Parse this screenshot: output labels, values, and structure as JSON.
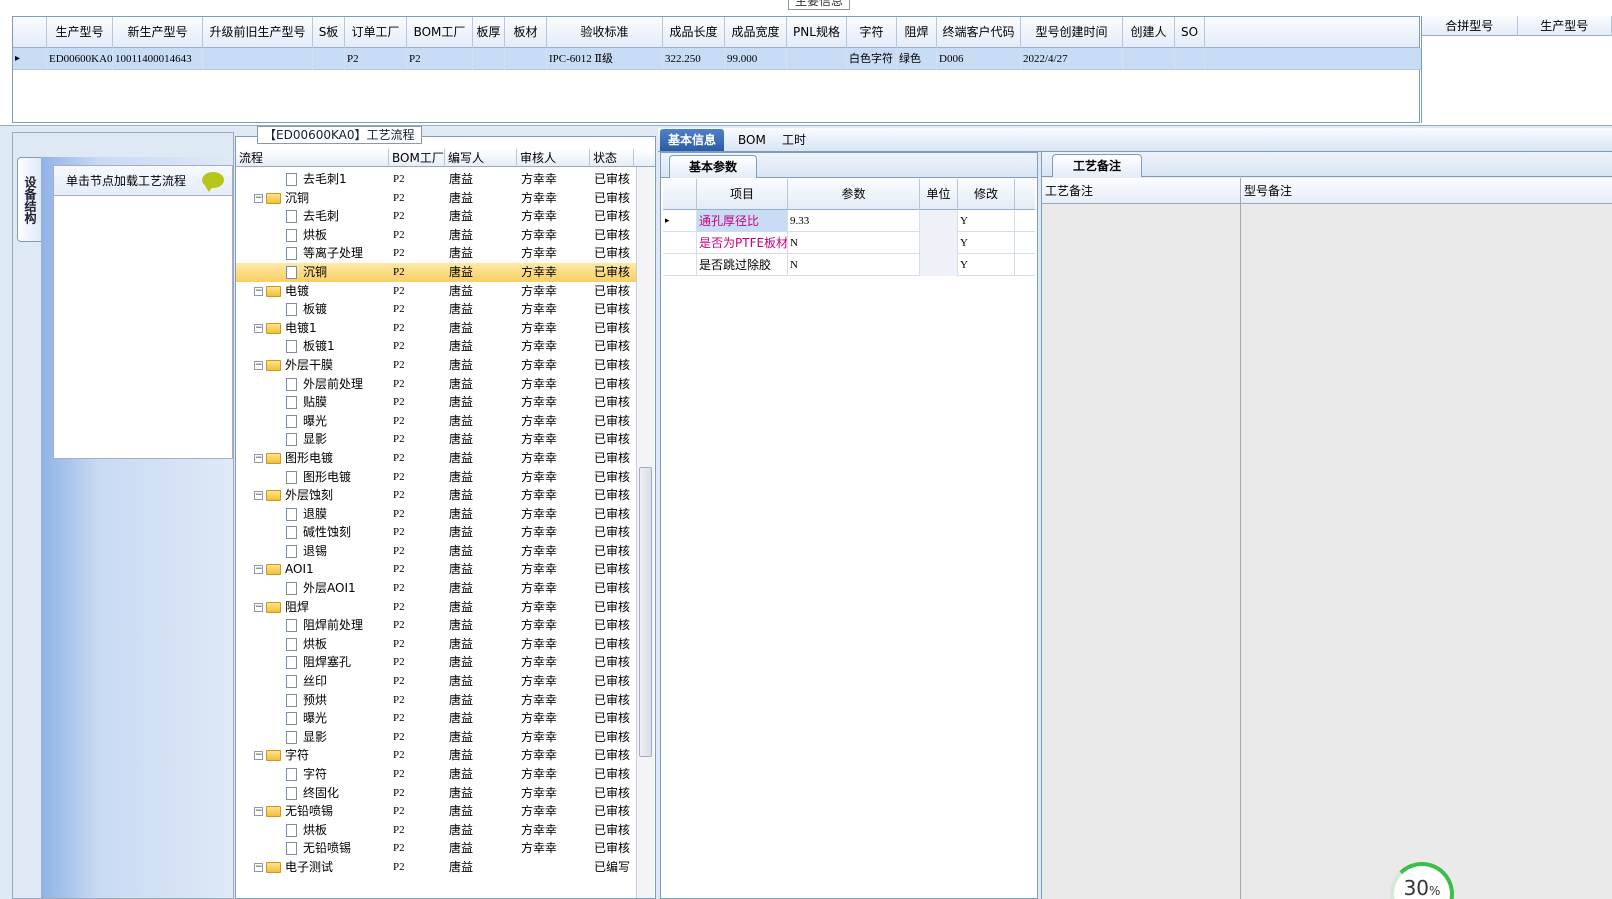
{
  "top": {
    "title": "主要信息",
    "headers": [
      "",
      "生产型号",
      "新生产型号",
      "升级前旧生产型号",
      "S板",
      "订单工厂",
      "BOM工厂",
      "板厚",
      "板材",
      "验收标准",
      "成品长度",
      "成品宽度",
      "PNL规格",
      "字符",
      "阻焊",
      "终端客户代码",
      "型号创建时间",
      "创建人",
      "SO"
    ],
    "row": [
      "",
      "ED00600KA0",
      "10011400014643",
      "",
      "",
      "P2",
      "P2",
      "",
      "",
      "IPC-6012 Ⅱ级",
      "322.250",
      "99.000",
      "",
      "白色字符",
      "绿色",
      "D006",
      "2022/4/27",
      "",
      ""
    ],
    "merge_headers": [
      "合拼型号",
      "生产型号"
    ]
  },
  "left": {
    "side_tab": "设备结构",
    "load_text": "单击节点加载工艺流程"
  },
  "tree": {
    "caption": "【ED00600KA0】工艺流程",
    "headers": [
      "流程",
      "BOM工厂",
      "编写人",
      "审核人",
      "状态"
    ],
    "rows": [
      {
        "name": "去毛刺1",
        "type": "doc",
        "bom": "P2",
        "writer": "唐益",
        "reviewer": "方幸幸",
        "status": "已审核"
      },
      {
        "name": "沉铜",
        "type": "folder",
        "bom": "P2",
        "writer": "唐益",
        "reviewer": "方幸幸",
        "status": "已审核"
      },
      {
        "name": "去毛刺",
        "type": "doc",
        "bom": "P2",
        "writer": "唐益",
        "reviewer": "方幸幸",
        "status": "已审核"
      },
      {
        "name": "烘板",
        "type": "doc",
        "bom": "P2",
        "writer": "唐益",
        "reviewer": "方幸幸",
        "status": "已审核"
      },
      {
        "name": "等离子处理",
        "type": "doc",
        "bom": "P2",
        "writer": "唐益",
        "reviewer": "方幸幸",
        "status": "已审核"
      },
      {
        "name": "沉铜",
        "type": "doc",
        "bom": "P2",
        "writer": "唐益",
        "reviewer": "方幸幸",
        "status": "已审核",
        "selected": true
      },
      {
        "name": "电镀",
        "type": "folder",
        "bom": "P2",
        "writer": "唐益",
        "reviewer": "方幸幸",
        "status": "已审核"
      },
      {
        "name": "板镀",
        "type": "doc",
        "bom": "P2",
        "writer": "唐益",
        "reviewer": "方幸幸",
        "status": "已审核"
      },
      {
        "name": "电镀1",
        "type": "folder",
        "bom": "P2",
        "writer": "唐益",
        "reviewer": "方幸幸",
        "status": "已审核"
      },
      {
        "name": "板镀1",
        "type": "doc",
        "bom": "P2",
        "writer": "唐益",
        "reviewer": "方幸幸",
        "status": "已审核"
      },
      {
        "name": "外层干膜",
        "type": "folder",
        "bom": "P2",
        "writer": "唐益",
        "reviewer": "方幸幸",
        "status": "已审核"
      },
      {
        "name": "外层前处理",
        "type": "doc",
        "bom": "P2",
        "writer": "唐益",
        "reviewer": "方幸幸",
        "status": "已审核"
      },
      {
        "name": "贴膜",
        "type": "doc",
        "bom": "P2",
        "writer": "唐益",
        "reviewer": "方幸幸",
        "status": "已审核"
      },
      {
        "name": "曝光",
        "type": "doc",
        "bom": "P2",
        "writer": "唐益",
        "reviewer": "方幸幸",
        "status": "已审核"
      },
      {
        "name": "显影",
        "type": "doc",
        "bom": "P2",
        "writer": "唐益",
        "reviewer": "方幸幸",
        "status": "已审核"
      },
      {
        "name": "图形电镀",
        "type": "folder",
        "bom": "P2",
        "writer": "唐益",
        "reviewer": "方幸幸",
        "status": "已审核"
      },
      {
        "name": "图形电镀",
        "type": "doc",
        "bom": "P2",
        "writer": "唐益",
        "reviewer": "方幸幸",
        "status": "已审核"
      },
      {
        "name": "外层蚀刻",
        "type": "folder",
        "bom": "P2",
        "writer": "唐益",
        "reviewer": "方幸幸",
        "status": "已审核"
      },
      {
        "name": "退膜",
        "type": "doc",
        "bom": "P2",
        "writer": "唐益",
        "reviewer": "方幸幸",
        "status": "已审核"
      },
      {
        "name": "碱性蚀刻",
        "type": "doc",
        "bom": "P2",
        "writer": "唐益",
        "reviewer": "方幸幸",
        "status": "已审核"
      },
      {
        "name": "退锡",
        "type": "doc",
        "bom": "P2",
        "writer": "唐益",
        "reviewer": "方幸幸",
        "status": "已审核"
      },
      {
        "name": "AOI1",
        "type": "folder",
        "bom": "P2",
        "writer": "唐益",
        "reviewer": "方幸幸",
        "status": "已审核"
      },
      {
        "name": "外层AOI1",
        "type": "doc",
        "bom": "P2",
        "writer": "唐益",
        "reviewer": "方幸幸",
        "status": "已审核"
      },
      {
        "name": "阻焊",
        "type": "folder",
        "bom": "P2",
        "writer": "唐益",
        "reviewer": "方幸幸",
        "status": "已审核"
      },
      {
        "name": "阻焊前处理",
        "type": "doc",
        "bom": "P2",
        "writer": "唐益",
        "reviewer": "方幸幸",
        "status": "已审核"
      },
      {
        "name": "烘板",
        "type": "doc",
        "bom": "P2",
        "writer": "唐益",
        "reviewer": "方幸幸",
        "status": "已审核"
      },
      {
        "name": "阻焊塞孔",
        "type": "doc",
        "bom": "P2",
        "writer": "唐益",
        "reviewer": "方幸幸",
        "status": "已审核"
      },
      {
        "name": "丝印",
        "type": "doc",
        "bom": "P2",
        "writer": "唐益",
        "reviewer": "方幸幸",
        "status": "已审核"
      },
      {
        "name": "预烘",
        "type": "doc",
        "bom": "P2",
        "writer": "唐益",
        "reviewer": "方幸幸",
        "status": "已审核"
      },
      {
        "name": "曝光",
        "type": "doc",
        "bom": "P2",
        "writer": "唐益",
        "reviewer": "方幸幸",
        "status": "已审核"
      },
      {
        "name": "显影",
        "type": "doc",
        "bom": "P2",
        "writer": "唐益",
        "reviewer": "方幸幸",
        "status": "已审核"
      },
      {
        "name": "字符",
        "type": "folder",
        "bom": "P2",
        "writer": "唐益",
        "reviewer": "方幸幸",
        "status": "已审核"
      },
      {
        "name": "字符",
        "type": "doc",
        "bom": "P2",
        "writer": "唐益",
        "reviewer": "方幸幸",
        "status": "已审核"
      },
      {
        "name": "终固化",
        "type": "doc",
        "bom": "P2",
        "writer": "唐益",
        "reviewer": "方幸幸",
        "status": "已审核"
      },
      {
        "name": "无铅喷锡",
        "type": "folder",
        "bom": "P2",
        "writer": "唐益",
        "reviewer": "方幸幸",
        "status": "已审核"
      },
      {
        "name": "烘板",
        "type": "doc",
        "bom": "P2",
        "writer": "唐益",
        "reviewer": "方幸幸",
        "status": "已审核"
      },
      {
        "name": "无铅喷锡",
        "type": "doc",
        "bom": "P2",
        "writer": "唐益",
        "reviewer": "方幸幸",
        "status": "已审核"
      },
      {
        "name": "电子测试",
        "type": "folder",
        "bom": "P2",
        "writer": "唐益",
        "reviewer": "",
        "status": "已编写"
      }
    ]
  },
  "tabs": [
    "基本信息",
    "BOM",
    "工时"
  ],
  "basic": {
    "tab": "基本参数",
    "headers": [
      "",
      "项目",
      "参数",
      "单位",
      "修改"
    ],
    "rows": [
      {
        "item": "通孔厚径比",
        "value": "9.33",
        "unit": "",
        "modify": "Y"
      },
      {
        "item": "是否为PTFE板材",
        "value": "N",
        "unit": "",
        "modify": "Y"
      },
      {
        "item": "是否跳过除胶",
        "value": "N",
        "unit": "",
        "modify": "Y"
      }
    ]
  },
  "notes": {
    "tab": "工艺备注",
    "headers": [
      "工艺备注",
      "型号备注"
    ]
  },
  "progress": {
    "value": "30",
    "unit": "%"
  },
  "colors": {
    "accent": "#2b5ba8",
    "selection": "#c9dcf5",
    "tree_highlight": "#f9cf62",
    "param_highlight": "#c8007e"
  }
}
